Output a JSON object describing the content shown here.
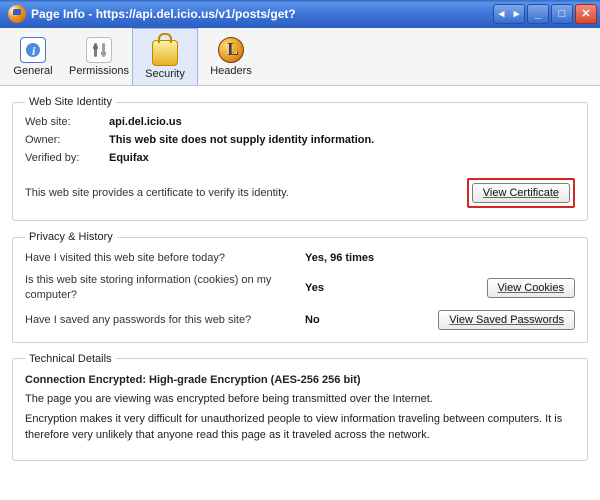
{
  "window": {
    "title_prefix": "Page Info -",
    "url": "https://api.del.icio.us/v1/posts/get?"
  },
  "tabs": {
    "general": "General",
    "permissions": "Permissions",
    "security": "Security",
    "headers": "Headers"
  },
  "identity": {
    "legend": "Web Site Identity",
    "website_label": "Web site:",
    "website_value": "api.del.icio.us",
    "owner_label": "Owner:",
    "owner_value": "This web site does not supply identity information.",
    "verified_label": "Verified by:",
    "verified_value": "Equifax",
    "cert_msg": "This web site provides a certificate to verify its identity.",
    "view_cert": "View Certificate"
  },
  "privacy": {
    "legend": "Privacy & History",
    "visited_q": "Have I visited this web site before today?",
    "visited_a": "Yes, 96 times",
    "cookies_q": "Is this web site storing information (cookies) on my computer?",
    "cookies_a": "Yes",
    "view_cookies": "View Cookies",
    "passwords_q": "Have I saved any passwords for this web site?",
    "passwords_a": "No",
    "view_passwords": "View Saved Passwords"
  },
  "technical": {
    "legend": "Technical Details",
    "heading": "Connection Encrypted: High-grade Encryption (AES-256 256 bit)",
    "line1": "The page you are viewing was encrypted before being transmitted over the Internet.",
    "line2": "Encryption makes it very difficult for unauthorized people to view information traveling between computers. It is therefore very unlikely that anyone read this page as it traveled across the network."
  }
}
